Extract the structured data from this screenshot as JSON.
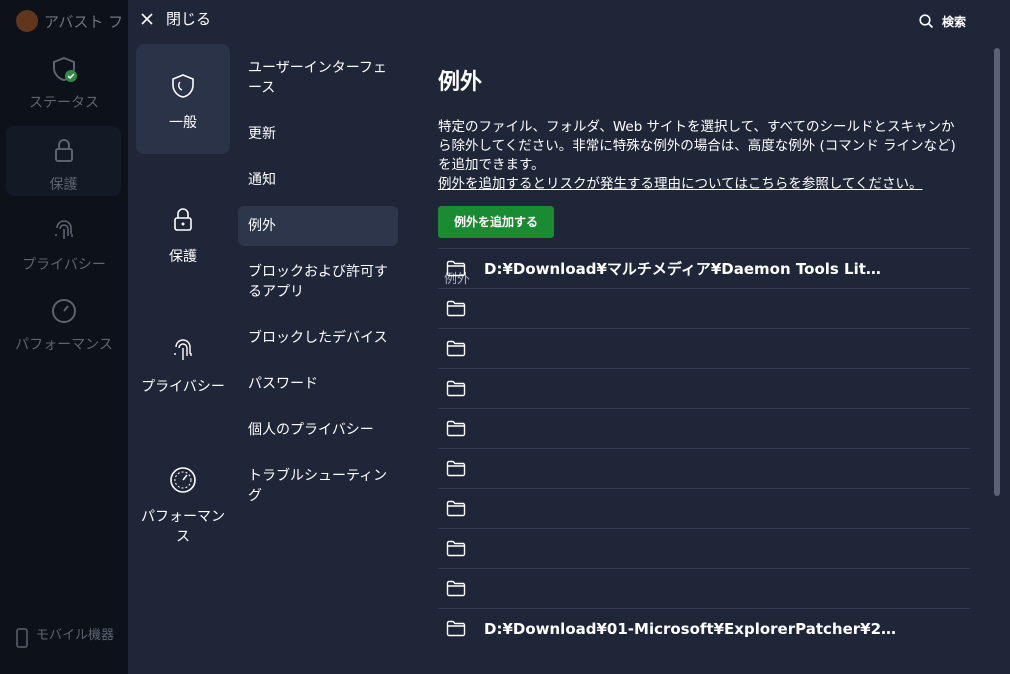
{
  "background": {
    "app_title": "アバスト フ",
    "nav": [
      "ステータス",
      "保護",
      "プライバシー",
      "パフォーマンス"
    ],
    "mobile": "モバイル機器"
  },
  "topbar": {
    "close_label": "閉じる",
    "search_label": "検索"
  },
  "categories": [
    {
      "label": "一般",
      "icon": "shield-icon"
    },
    {
      "label": "保護",
      "icon": "lock-icon"
    },
    {
      "label": "プライバシー",
      "icon": "fingerprint-icon"
    },
    {
      "label": "パフォーマンス",
      "icon": "gauge-icon"
    }
  ],
  "submenu": [
    "ユーザーインターフェース",
    "更新",
    "通知",
    "例外",
    "ブロックおよび許可するアプリ",
    "ブロックしたデバイス",
    "パスワード",
    "個人のプライバシー",
    "トラブルシューティング"
  ],
  "content": {
    "title": "例外",
    "description": "特定のファイル、フォルダ、Web サイトを選択して、すべてのシールドとスキャンから除外してください。非常に特殊な例外の場合は、高度な例外 (コマンド ラインなど) を追加できます。",
    "link": "例外を追加するとリスクが発生する理由についてはこちらを参照してください。",
    "add_button": "例外を追加する",
    "list_header": "例外",
    "rows": [
      "D:¥Download¥マルチメディア¥Daemon Tools Lit…",
      "",
      "",
      "",
      "",
      "",
      "",
      "",
      "",
      "D:¥Download¥01-Microsoft¥ExplorerPatcher¥2…"
    ]
  }
}
